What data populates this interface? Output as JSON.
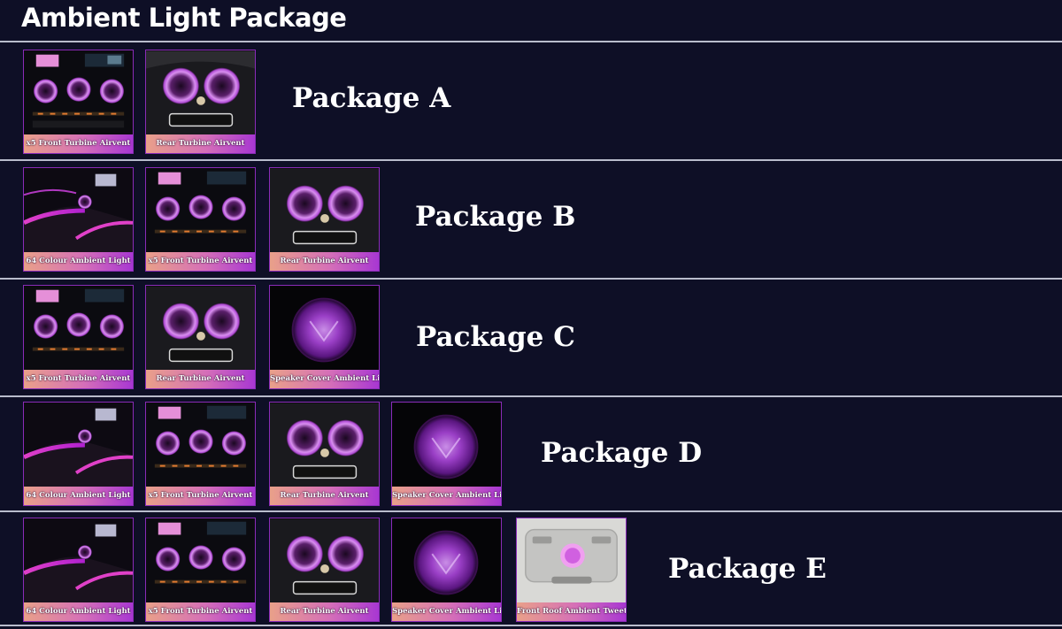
{
  "header": {
    "title": "Ambient Light Package"
  },
  "captions": {
    "ambient64": "64 Colour Ambient Light",
    "front": "x5 Front Turbine Airvent",
    "rear": "Rear Turbine Airvent",
    "speaker": "Speaker Cover Ambient Light",
    "roof": "Front Roof Ambient Tweeter"
  },
  "packages": {
    "a": {
      "label": "Package A"
    },
    "b": {
      "label": "Package B"
    },
    "c": {
      "label": "Package C"
    },
    "d": {
      "label": "Package D"
    },
    "e": {
      "label": "Package E"
    }
  },
  "colors": {
    "background": "#0e0f26",
    "accent_purple": "#a837d2",
    "caption_gradient_start": "#e9a089",
    "divider": "#b9bccc"
  }
}
